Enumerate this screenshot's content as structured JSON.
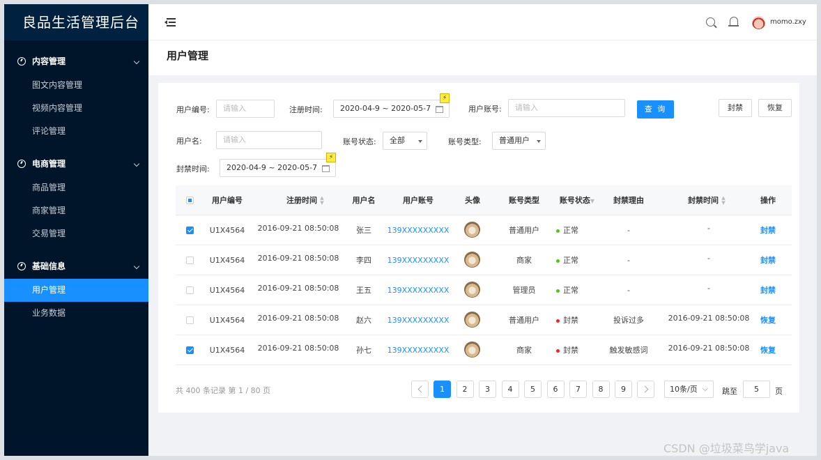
{
  "app": {
    "title": "良品生活管理后台"
  },
  "sidebar": {
    "groups": [
      {
        "label": "内容管理",
        "items": [
          "图文内容管理",
          "视频内容管理",
          "评论管理"
        ]
      },
      {
        "label": "电商管理",
        "items": [
          "商品管理",
          "商家管理",
          "交易管理"
        ]
      },
      {
        "label": "基础信息",
        "items": [
          "用户管理",
          "业务数据"
        ]
      }
    ],
    "active_item": "用户管理"
  },
  "header": {
    "username": "momo.zxy",
    "icons": [
      "menu-fold-icon",
      "search-icon",
      "bell-icon",
      "avatar"
    ]
  },
  "page": {
    "title": "用户管理"
  },
  "filters": {
    "user_id": {
      "label": "用户编号:",
      "placeholder": "请输入"
    },
    "reg_time": {
      "label": "注册时间:",
      "value": "2020-04-9 ~ 2020-05-7"
    },
    "account": {
      "label": "用户账号:",
      "placeholder": "请输入"
    },
    "username": {
      "label": "用户名:",
      "placeholder": "请输入"
    },
    "status": {
      "label": "账号状态:",
      "value": "全部"
    },
    "type": {
      "label": "账号类型:",
      "value": "普通用户"
    },
    "ban_time": {
      "label": "封禁时间:",
      "value": "2020-04-9 ~ 2020-05-7"
    },
    "query_label": "查 询",
    "ban_label": "封禁",
    "restore_label": "恢复"
  },
  "table": {
    "headers": [
      "用户编号",
      "注册时间",
      "用户名",
      "用户账号",
      "头像",
      "账号类型",
      "账号状态",
      "封禁理由",
      "封禁时间",
      "操作"
    ],
    "rows": [
      {
        "checked": true,
        "id": "U1X4564",
        "reg": "2016-09-21  08:50:08",
        "name": "张三",
        "account": "139XXXXXXXXX",
        "type": "普通用户",
        "status": "正常",
        "status_color": "#52c41a",
        "reason": "-",
        "ban_time": "-",
        "action": "封禁"
      },
      {
        "checked": false,
        "id": "U1X4564",
        "reg": "2016-09-21  08:50:08",
        "name": "李四",
        "account": "139XXXXXXXXX",
        "type": "商家",
        "status": "正常",
        "status_color": "#52c41a",
        "reason": "-",
        "ban_time": "-",
        "action": "封禁"
      },
      {
        "checked": false,
        "id": "U1X4564",
        "reg": "2016-09-21  08:50:08",
        "name": "王五",
        "account": "139XXXXXXXXX",
        "type": "管理员",
        "status": "正常",
        "status_color": "#52c41a",
        "reason": "-",
        "ban_time": "-",
        "action": "封禁"
      },
      {
        "checked": false,
        "id": "U1X4564",
        "reg": "2016-09-21  08:50:08",
        "name": "赵六",
        "account": "139XXXXXXXXX",
        "type": "普通用户",
        "status": "封禁",
        "status_color": "#f5222d",
        "reason": "投诉过多",
        "ban_time": "2016-09-21  08:50:08",
        "action": "恢复"
      },
      {
        "checked": true,
        "id": "U1X4564",
        "reg": "2016-09-21  08:50:08",
        "name": "孙七",
        "account": "139XXXXXXXXX",
        "type": "商家",
        "status": "封禁",
        "status_color": "#f5222d",
        "reason": "触发敏感词",
        "ban_time": "2016-09-21  08:50:08",
        "action": "恢复"
      }
    ]
  },
  "pagination": {
    "info": "共 400 条记录 第 1 / 80 页",
    "pages": [
      "1",
      "2",
      "3",
      "4",
      "5",
      "6",
      "7",
      "8",
      "9"
    ],
    "current": "1",
    "page_size": "10条/页",
    "jump_label": "跳至",
    "jump_value": "5",
    "page_suffix": "页"
  },
  "watermark": "CSDN @垃圾菜鸟学java"
}
